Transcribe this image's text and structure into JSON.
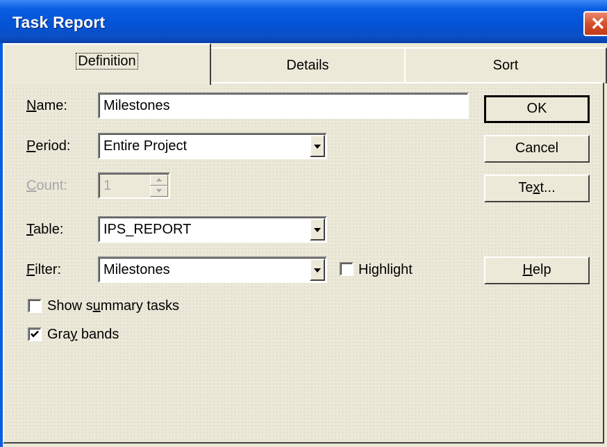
{
  "window": {
    "title": "Task Report",
    "close_glyph": "✕"
  },
  "tabs": [
    {
      "label": "Definition",
      "active": true
    },
    {
      "label": "Details",
      "active": false
    },
    {
      "label": "Sort",
      "active": false
    }
  ],
  "form": {
    "name": {
      "label_pre": "",
      "label_key": "N",
      "label_post": "ame:",
      "value": "Milestones"
    },
    "period": {
      "label_pre": "",
      "label_key": "P",
      "label_post": "eriod:",
      "value": "Entire Project"
    },
    "count": {
      "label_pre": "",
      "label_key": "C",
      "label_post": "ount:",
      "value": "1",
      "disabled": true
    },
    "table": {
      "label_pre": "",
      "label_key": "T",
      "label_post": "able:",
      "value": "IPS_REPORT"
    },
    "filter": {
      "label_pre": "",
      "label_key": "F",
      "label_post": "ilter:",
      "value": "Milestones"
    },
    "highlight": {
      "label_pre": "Hi",
      "label_key": "g",
      "label_post": "hlight",
      "checked": false
    },
    "show_summary": {
      "label_pre": "Show s",
      "label_key": "u",
      "label_post": "mmary tasks",
      "checked": false
    },
    "gray_bands": {
      "label_pre": "Gra",
      "label_key": "y",
      "label_post": " bands",
      "checked": true
    }
  },
  "buttons": {
    "ok": {
      "label": "OK"
    },
    "cancel": {
      "label": "Cancel"
    },
    "text": {
      "label_pre": "Te",
      "label_key": "x",
      "label_post": "t..."
    },
    "help": {
      "label_pre": "",
      "label_key": "H",
      "label_post": "elp"
    }
  },
  "icons": [
    "close-icon",
    "dropdown-arrow-icon",
    "spin-up-icon",
    "spin-down-icon",
    "checkmark-icon"
  ],
  "colors": {
    "titlebar": "#0453d6",
    "dialog_bg": "#ece9d8",
    "close_button": "#d4502d"
  }
}
